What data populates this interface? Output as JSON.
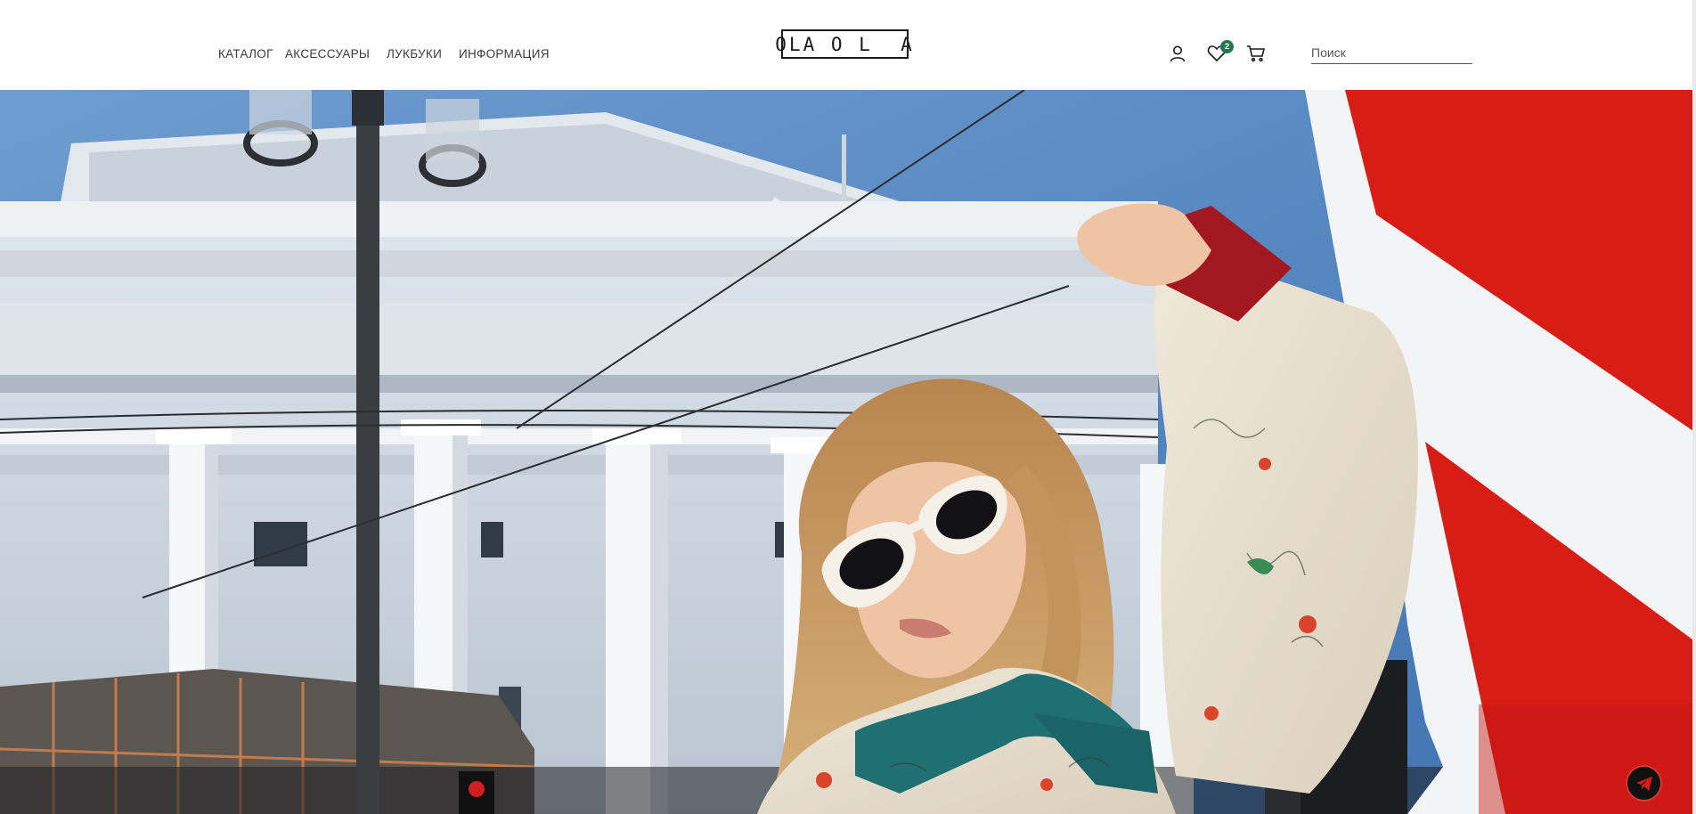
{
  "header": {
    "nav": [
      {
        "label": "КАТАЛОГ"
      },
      {
        "label": "АКСЕССУАРЫ"
      },
      {
        "label": "ЛУКБУКИ"
      },
      {
        "label": "ИНФОРМАЦИЯ"
      }
    ],
    "logo": "OLA O L  A",
    "icons": {
      "account": "user-icon",
      "favorites": "heart-icon",
      "cart": "cart-icon"
    },
    "favorites_count": "2",
    "search": {
      "placeholder": "Поиск",
      "value": ""
    }
  },
  "hero": {
    "image_alt": "hero-photo",
    "telegram_icon": "telegram-icon"
  },
  "colors": {
    "badge": "#1f7a50",
    "sky": "#4a7db8",
    "sign_red": "#d81d17"
  }
}
